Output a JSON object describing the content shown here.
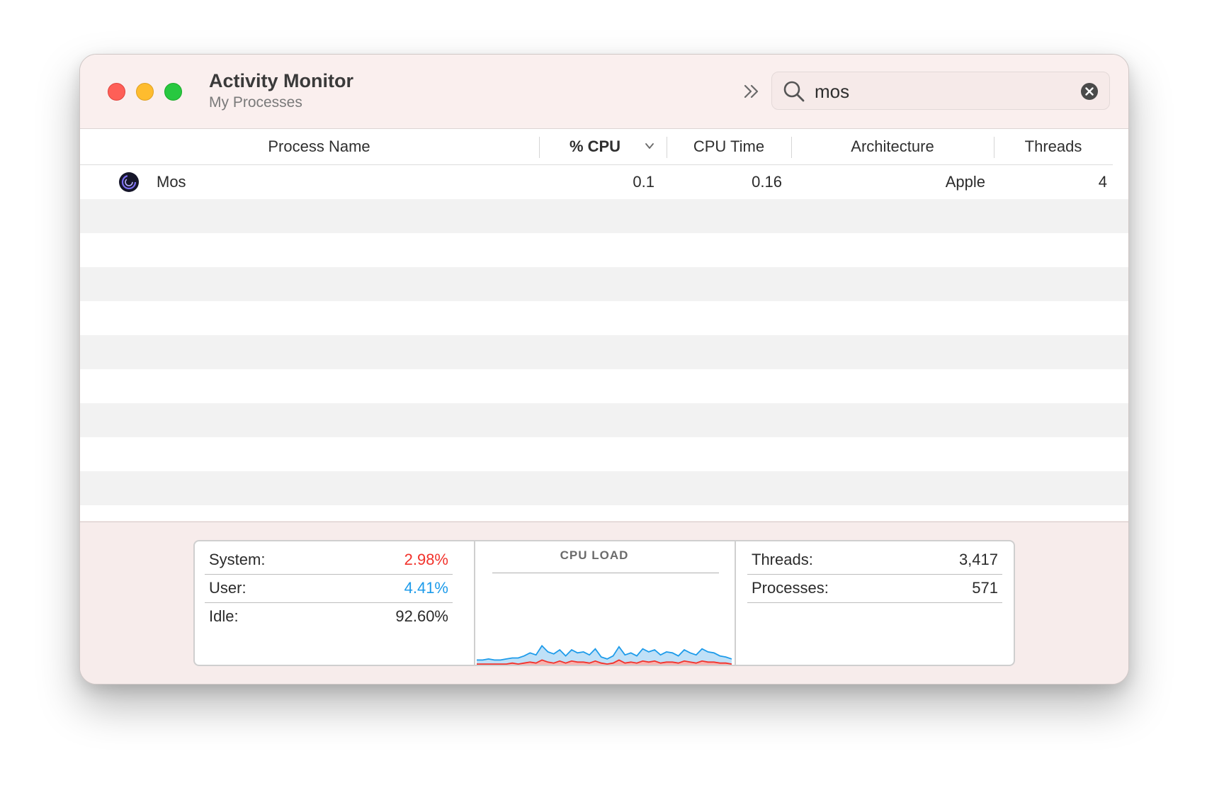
{
  "window": {
    "title": "Activity Monitor",
    "subtitle": "My Processes"
  },
  "toolbar": {
    "overflow_icon": "double-chevron-right-icon",
    "search": {
      "value": "mos",
      "icon": "search-icon",
      "clear_icon": "clear-circle-icon"
    }
  },
  "table": {
    "columns": [
      {
        "label": "Process Name"
      },
      {
        "label": "% CPU",
        "sorted": "descending"
      },
      {
        "label": "CPU Time"
      },
      {
        "label": "Architecture"
      },
      {
        "label": "Threads"
      }
    ],
    "rows": [
      {
        "name": "Mos",
        "icon": "mos-app-icon",
        "cpu": "0.1",
        "cpu_time": "0.16",
        "architecture": "Apple",
        "threads": "4"
      }
    ]
  },
  "footer": {
    "system": {
      "label": "System:",
      "value": "2.98%"
    },
    "user": {
      "label": "User:",
      "value": "4.41%"
    },
    "idle": {
      "label": "Idle:",
      "value": "92.60%"
    },
    "cpu_load_title": "CPU LOAD",
    "threads": {
      "label": "Threads:",
      "value": "3,417"
    },
    "processes": {
      "label": "Processes:",
      "value": "571"
    },
    "colors": {
      "system": "#f2322b",
      "user": "#1d9bea"
    },
    "cpu_load_history": {
      "user_pct": [
        4,
        4,
        5,
        4,
        4,
        5,
        5,
        6,
        7,
        9,
        8,
        14,
        10,
        9,
        11,
        7,
        11,
        9,
        10,
        8,
        12,
        6,
        5,
        7,
        13,
        8,
        9,
        7,
        12,
        10,
        11,
        8,
        10,
        9,
        7,
        11,
        9,
        8,
        12,
        10,
        9,
        7,
        6,
        5
      ],
      "system_pct": [
        2,
        2,
        2,
        2,
        2,
        2,
        3,
        2,
        3,
        4,
        3,
        6,
        4,
        3,
        5,
        3,
        5,
        4,
        4,
        3,
        5,
        3,
        2,
        3,
        6,
        3,
        4,
        3,
        5,
        4,
        5,
        3,
        4,
        4,
        3,
        5,
        4,
        3,
        5,
        4,
        4,
        3,
        3,
        2
      ]
    }
  }
}
